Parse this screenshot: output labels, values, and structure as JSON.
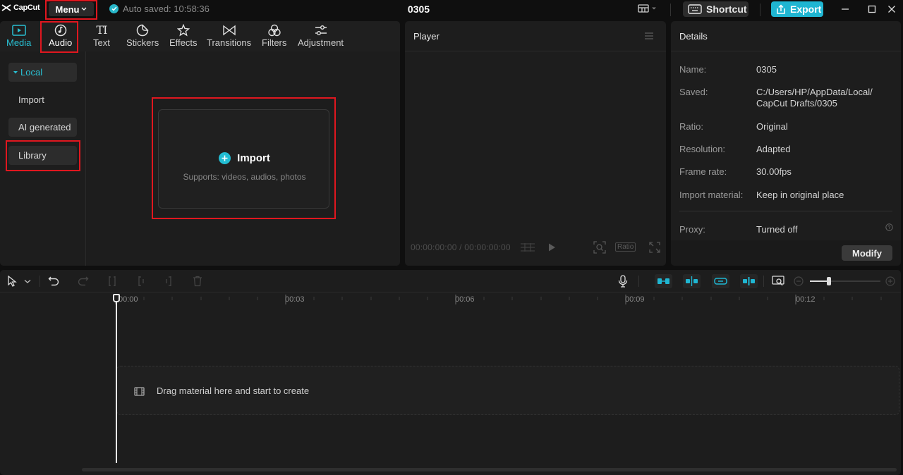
{
  "app": {
    "logo": "CapCut",
    "menu_label": "Menu",
    "autosave_text": "Auto saved: 10:58:36",
    "project_title": "0305",
    "shortcut_label": "Shortcut",
    "export_label": "Export",
    "accent_color": "#1fb6d2",
    "highlight_color": "#e0171f"
  },
  "tabs": [
    {
      "label": "Media",
      "icon": "media-icon",
      "active": true
    },
    {
      "label": "Audio",
      "icon": "audio-icon",
      "active": false
    },
    {
      "label": "Text",
      "icon": "text-icon",
      "active": false
    },
    {
      "label": "Stickers",
      "icon": "stickers-icon",
      "active": false
    },
    {
      "label": "Effects",
      "icon": "effects-icon",
      "active": false
    },
    {
      "label": "Transitions",
      "icon": "transitions-icon",
      "active": false
    },
    {
      "label": "Filters",
      "icon": "filters-icon",
      "active": false
    },
    {
      "label": "Adjustment",
      "icon": "adjustment-icon",
      "active": false
    }
  ],
  "sidebar": {
    "items": [
      {
        "label": "Local",
        "active": true
      },
      {
        "label": "Import",
        "active": false
      },
      {
        "label": "AI generated",
        "active": false
      },
      {
        "label": "Library",
        "active": false
      }
    ]
  },
  "import_card": {
    "title": "Import",
    "subtitle": "Supports: videos, audios, photos"
  },
  "player": {
    "title": "Player",
    "timecode": "00:00:00:00 / 00:00:00:00",
    "ratio_label": "Ratio"
  },
  "details": {
    "title": "Details",
    "rows": [
      {
        "label": "Name:",
        "value": "0305"
      },
      {
        "label": "Saved:",
        "value": "C:/Users/HP/AppData/Local/",
        "value2": "CapCut Drafts/0305"
      },
      {
        "label": "Ratio:",
        "value": "Original"
      },
      {
        "label": "Resolution:",
        "value": "Adapted"
      },
      {
        "label": "Frame rate:",
        "value": "30.00fps"
      },
      {
        "label": "Import material:",
        "value": "Keep in original place"
      }
    ],
    "proxy_label": "Proxy:",
    "proxy_value": "Turned off",
    "modify_label": "Modify"
  },
  "timeline": {
    "ticks": [
      "00:00",
      "00:03",
      "00:06",
      "00:09",
      "00:12"
    ],
    "drop_text": "Drag material here and start to create"
  }
}
